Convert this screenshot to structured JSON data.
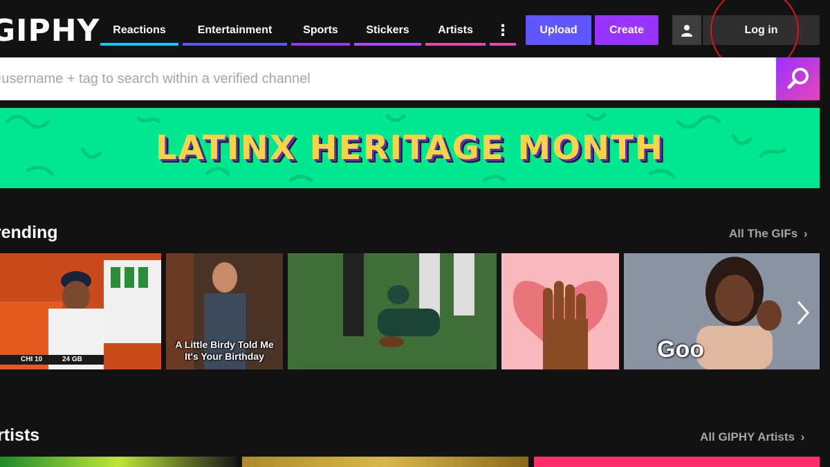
{
  "header": {
    "logo": "GIPHY",
    "nav": [
      {
        "label": "Reactions",
        "color": "#00ccff"
      },
      {
        "label": "Entertainment",
        "color": "#6157ff"
      },
      {
        "label": "Sports",
        "color": "#9933ff"
      },
      {
        "label": "Stickers",
        "color": "#b542ff"
      },
      {
        "label": "Artists",
        "color": "#e646b6"
      }
    ],
    "more_icon": "vertical-ellipsis-icon",
    "upload_label": "Upload",
    "create_label": "Create",
    "user_icon": "user-icon",
    "login_label": "Log in"
  },
  "search": {
    "placeholder": "@username + tag to search within a verified channel",
    "icon": "search-icon"
  },
  "banner": {
    "title": "LATINX HERITAGE MONTH",
    "background_color": "#00e88f"
  },
  "trending": {
    "title": "Trending",
    "link_label": "All The GIFs",
    "tiles": [
      {
        "name": "football-coach-phone-gif",
        "score_left": "CHI 10",
        "score_right": "24 GB"
      },
      {
        "name": "birthday-gif",
        "caption": "A Little Birdy Told Me It's Your Birthday"
      },
      {
        "name": "eagles-player-gif"
      },
      {
        "name": "hand-heart-sticker"
      },
      {
        "name": "woman-signing-gif",
        "caption": "Goo"
      }
    ],
    "next_icon": "chevron-right-icon"
  },
  "artists": {
    "title": "Artists",
    "link_label": "All GIPHY Artists"
  }
}
